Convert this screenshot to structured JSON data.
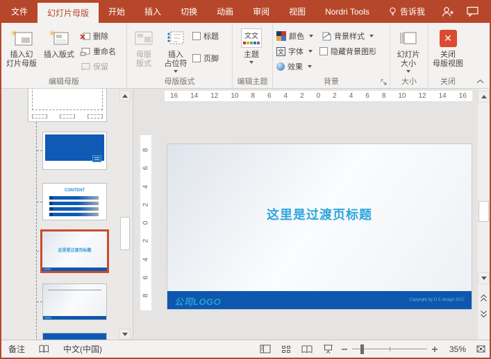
{
  "accent": "#B7472A",
  "tabs": {
    "file": "文件",
    "items": [
      {
        "label": "幻灯片母版",
        "selected": true
      },
      {
        "label": "开始"
      },
      {
        "label": "插入"
      },
      {
        "label": "切换"
      },
      {
        "label": "动画"
      },
      {
        "label": "审阅"
      },
      {
        "label": "视图"
      },
      {
        "label": "Nordri Tools"
      },
      {
        "label": "告诉我"
      }
    ]
  },
  "ribbon": {
    "edit_master": {
      "label": "编辑母版",
      "insert_slide_master": "插入幻\n灯片母版",
      "insert_layout": "插入版式",
      "delete": "删除",
      "rename": "重命名",
      "preserve": "保留"
    },
    "master_layout": {
      "label": "母版版式",
      "master_layout_btn": "母版\n版式",
      "insert_placeholder": "插入\n占位符",
      "title_checkbox": "标题",
      "footer_checkbox": "页脚"
    },
    "edit_theme": {
      "label": "编辑主题",
      "themes": "主题",
      "themes_icon_text": "文文"
    },
    "background": {
      "label": "背景",
      "colors": "颜色",
      "fonts": "字体",
      "fonts_icon_text": "文",
      "effects": "效果",
      "background_styles": "背景样式",
      "hide_background_graphics": "隐藏背景图形"
    },
    "size": {
      "label": "大小",
      "slide_size": "幻灯片\n大小"
    },
    "close": {
      "label": "关闭",
      "close_master_view": "关闭\n母版视图",
      "close_x": "✕"
    }
  },
  "rulers": {
    "horizontal": [
      "16",
      "14",
      "12",
      "10",
      "8",
      "6",
      "4",
      "2",
      "0",
      "2",
      "4",
      "6",
      "8",
      "10",
      "12",
      "14",
      "16"
    ],
    "vertical": [
      "8",
      "6",
      "4",
      "2",
      "0",
      "2",
      "4",
      "6",
      "8"
    ]
  },
  "thumbnails": {
    "content_title": "CONTENT"
  },
  "slide": {
    "title": "这里是过渡页标题",
    "footer_logo": "公司LOGO",
    "footer_copyright": "Copyright by D.S design 2017"
  },
  "statusbar": {
    "notes": "备注",
    "language": "中文(中国)",
    "zoom_level": "35%"
  }
}
